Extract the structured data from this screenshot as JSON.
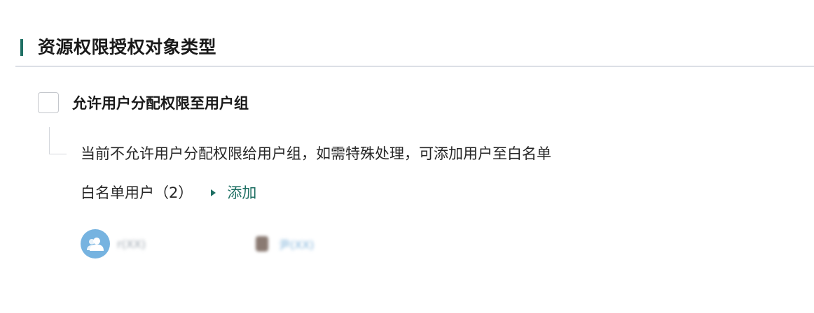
{
  "section": {
    "title": "资源权限授权对象类型"
  },
  "option": {
    "checkbox_label": "允许用户分配权限至用户组",
    "checked": false,
    "description": "当前不允许用户分配权限给用户组，如需特殊处理，可添加用户至白名单",
    "whitelist_label": "白名单用户（2）",
    "add_label": "添加"
  },
  "whitelist_users": [
    {
      "name": "r(XX)",
      "avatar": "group-avatar-icon"
    },
    {
      "name": "尹(XX)",
      "avatar": "photo-avatar"
    }
  ],
  "colors": {
    "accent": "#1e6f63",
    "avatar_bg": "#76b3e0",
    "divider": "#dcdfe6"
  }
}
